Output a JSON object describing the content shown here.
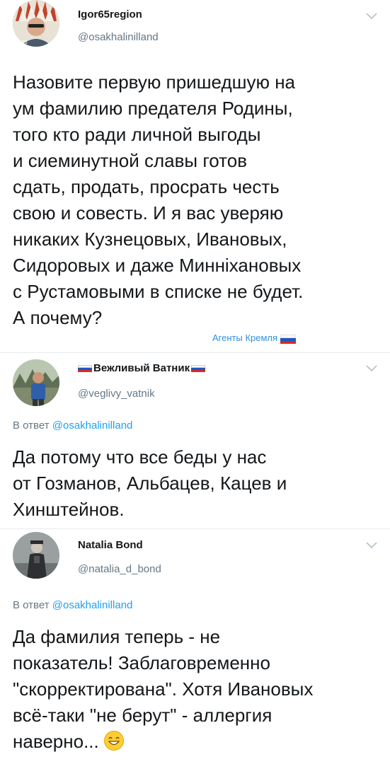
{
  "tweets": [
    {
      "name": "Igor65region",
      "handle": "@osakhalinilland",
      "reply_prefix": "",
      "reply_to": "",
      "lines": [
        "Назовите первую пришедшую на",
        "ум фамилию предателя Родины,",
        "того кто ради личной выгоды",
        "и сиеминутной славы готов",
        "сдать, продать, просрать честь",
        "свою и совесть. И я вас уверяю",
        "никаких Кузнецовых, Ивановых,",
        "Сидоровых и даже Минніхановых",
        "с Рустамовыми в списке не будет.",
        "А почему?"
      ]
    },
    {
      "name": "Вежливый Ватник",
      "handle": "@veglivy_vatnik",
      "reply_prefix": "В ответ",
      "reply_to": "@osakhalinilland",
      "lines": [
        "Да потому что все беды у нас",
        "от Гозманов, Альбацев, Кацев и",
        "Хинштейнов."
      ]
    },
    {
      "name": "Natalia Bond",
      "handle": "@natalia_d_bond",
      "reply_prefix": "В ответ",
      "reply_to": "@osakhalinilland",
      "lines": [
        "Да фамилия теперь - не",
        "показатель! Заблаговременно",
        "\"скорректирована\". Хотя Ивановых",
        "всё-таки \"не берут\" - аллергия",
        "наверно..."
      ]
    }
  ],
  "watermark": "Агенты Кремля",
  "colors": {
    "text": "#14171a",
    "secondary": "#657786",
    "link": "#1da1f2",
    "separator": "#e6ecf0",
    "watermark": "#2f8fe0"
  },
  "icons": [
    "chevron-down-icon",
    "russian-flag-icon",
    "grinning-emoji-icon"
  ]
}
